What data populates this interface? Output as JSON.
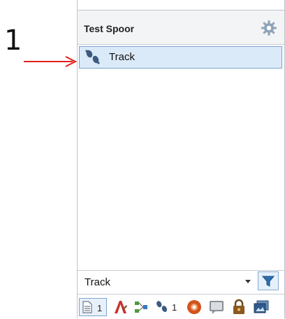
{
  "annotation": {
    "number": "1"
  },
  "panel": {
    "title": "Test Spoor",
    "settings_icon": "gear-icon"
  },
  "tree": {
    "items": [
      {
        "label": "Track",
        "icon": "footprints-icon",
        "selected": true
      }
    ]
  },
  "filter": {
    "selected": "Track",
    "filter_icon": "funnel-icon"
  },
  "toolbar": {
    "buttons": [
      {
        "name": "documents",
        "icon": "document-icon",
        "count": "1",
        "selected": true
      },
      {
        "name": "annotations",
        "icon": "red-a-icon"
      },
      {
        "name": "network",
        "icon": "network-icon"
      },
      {
        "name": "tracks",
        "icon": "footprints-icon",
        "count": "1"
      },
      {
        "name": "gps",
        "icon": "orange-circle-icon"
      },
      {
        "name": "chat",
        "icon": "chat-icon"
      },
      {
        "name": "lock",
        "icon": "lock-icon"
      },
      {
        "name": "images",
        "icon": "images-icon"
      }
    ]
  },
  "colors": {
    "selection_bg": "#dbeaf8",
    "selection_border": "#7da2ce",
    "arrow": "#e0201c"
  }
}
